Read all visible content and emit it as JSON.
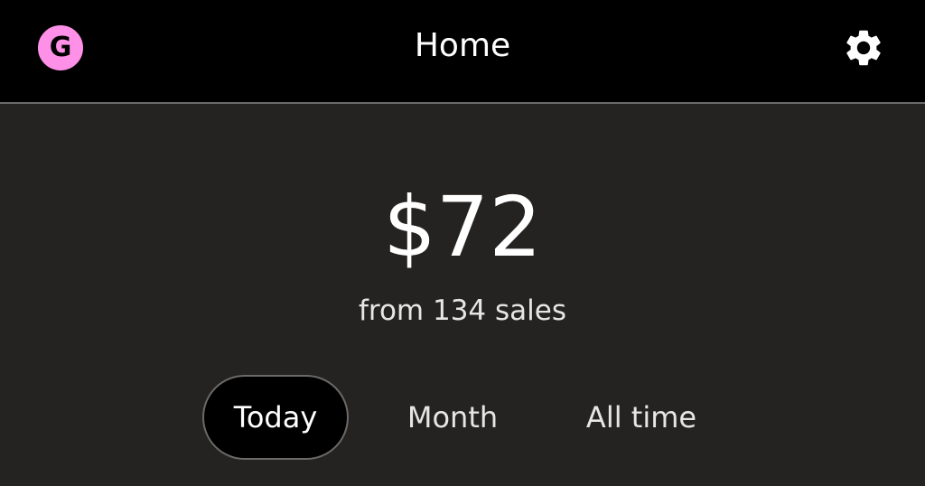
{
  "header": {
    "avatar_letter": "G",
    "title": "Home",
    "settings_icon": "gear-icon",
    "avatar_color": "#ff90e8"
  },
  "summary": {
    "amount": "$72",
    "subtitle": "from 134 sales"
  },
  "tabs": [
    {
      "label": "Today",
      "active": true
    },
    {
      "label": "Month",
      "active": false
    },
    {
      "label": "All time",
      "active": false
    }
  ],
  "colors": {
    "background": "#242322",
    "topbar": "#000000",
    "accent": "#ff90e8",
    "text": "#ffffff"
  }
}
